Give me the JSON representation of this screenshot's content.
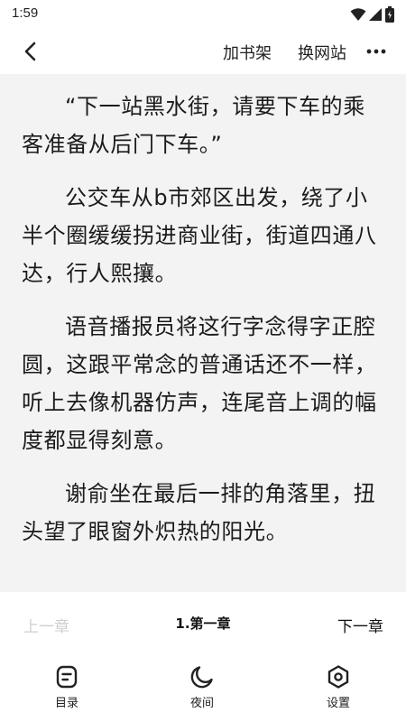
{
  "status": {
    "time": "1:59"
  },
  "toolbar": {
    "add_to_shelf": "加书架",
    "change_site": "换网站"
  },
  "content": {
    "paragraphs": [
      "“下一站黑水街，请要下车的乘客准备从后门下车。”",
      "公交车从b市郊区出发，绕了小半个圈缓缓拐进商业街，街道四通八达，行人熙攘。",
      "语音播报员将这行字念得字正腔圆，这跟平常念的普通话还不一样，听上去像机器仿声，连尾音上调的幅度都显得刻意。",
      "谢俞坐在最后一排的角落里，扭头望了眼窗外炽热的阳光。"
    ]
  },
  "chapter_nav": {
    "prev": "上一章",
    "current": "1.第一章",
    "next": "下一章"
  },
  "bottom_tools": {
    "toc": "目录",
    "night": "夜间",
    "settings": "设置"
  },
  "icons": {
    "back": "chevron-left-icon",
    "more": "more-dots-icon",
    "toc": "document-list-icon",
    "night": "moon-icon",
    "settings": "gear-icon"
  },
  "colors": {
    "page_bg": "#f3f3f3",
    "bar_bg": "#ffffff",
    "text": "#1b1b1b",
    "disabled": "#cfcfcf"
  }
}
